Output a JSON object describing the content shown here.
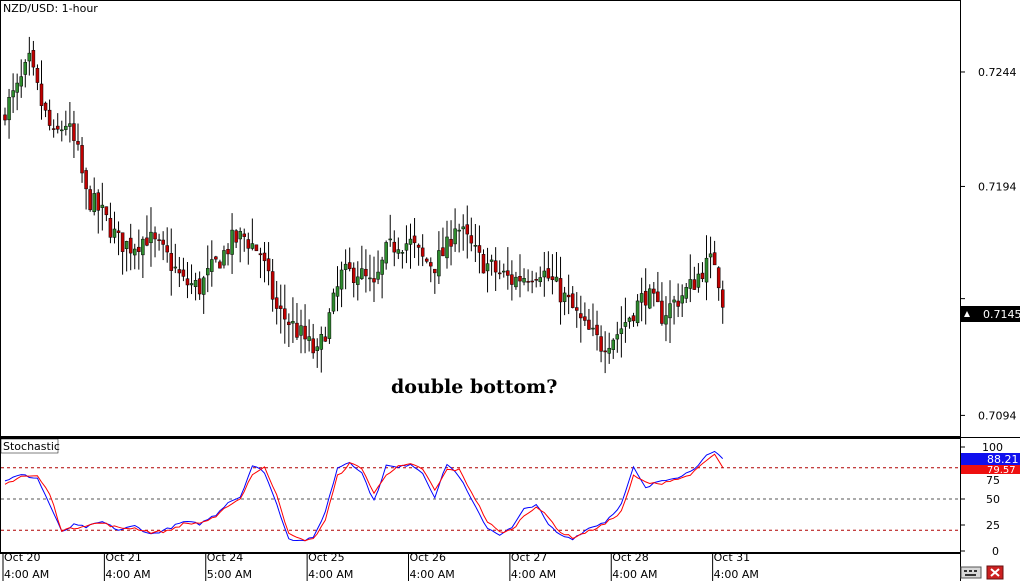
{
  "symbol_label": "NZD/USD: 1-hour",
  "indicator_label": "Stochastic",
  "annotation": "double bottom?",
  "current_price": "0.7145",
  "stoch_main_value": "88.21",
  "stoch_signal_value": "79.57",
  "colors": {
    "bull": "#2e8b2e",
    "bear": "#c00000",
    "stoch_main": "#0000ff",
    "stoch_signal": "#ff0000",
    "grid_dash": "#b00000",
    "badge_main": "#1010ee",
    "badge_signal": "#ee1010"
  },
  "chart_data": [
    {
      "type": "candlestick",
      "title": "NZD/USD: 1-hour",
      "ylim": [
        0.7085,
        0.7275
      ],
      "y_ticks": [
        "0.7244",
        "0.7194",
        "0.7145",
        "0.7094"
      ],
      "y_tick_values": [
        0.7244,
        0.7194,
        0.7145,
        0.7094
      ],
      "x_ticks": [
        {
          "top": "Oct 20",
          "bottom": "4:00 AM"
        },
        {
          "top": "Oct 21",
          "bottom": "4:00 AM"
        },
        {
          "top": "Oct 24",
          "bottom": "5:00 AM"
        },
        {
          "top": "Oct 25",
          "bottom": "4:00 AM"
        },
        {
          "top": "Oct 26",
          "bottom": "4:00 AM"
        },
        {
          "top": "Oct 27",
          "bottom": "4:00 AM"
        },
        {
          "top": "Oct 28",
          "bottom": "4:00 AM"
        },
        {
          "top": "Oct 31",
          "bottom": "4:00 AM"
        }
      ],
      "x_tick_bar_index": [
        0,
        25,
        50,
        75,
        100,
        125,
        150,
        175
      ],
      "close_path": [
        [
          0,
          0.7228
        ],
        [
          3,
          0.7236
        ],
        [
          6,
          0.7248
        ],
        [
          9,
          0.723
        ],
        [
          12,
          0.7215
        ],
        [
          15,
          0.7222
        ],
        [
          18,
          0.7208
        ],
        [
          20,
          0.719
        ],
        [
          24,
          0.7182
        ],
        [
          28,
          0.717
        ],
        [
          31,
          0.7168
        ],
        [
          35,
          0.7172
        ],
        [
          40,
          0.7163
        ],
        [
          44,
          0.7152
        ],
        [
          48,
          0.715
        ],
        [
          52,
          0.716
        ],
        [
          56,
          0.717
        ],
        [
          59,
          0.7172
        ],
        [
          63,
          0.7165
        ],
        [
          67,
          0.714
        ],
        [
          70,
          0.7135
        ],
        [
          74,
          0.7127
        ],
        [
          77,
          0.712
        ],
        [
          80,
          0.7137
        ],
        [
          83,
          0.7155
        ],
        [
          87,
          0.7157
        ],
        [
          91,
          0.7149
        ],
        [
          94,
          0.7165
        ],
        [
          97,
          0.717
        ],
        [
          100,
          0.7169
        ],
        [
          103,
          0.7162
        ],
        [
          106,
          0.716
        ],
        [
          109,
          0.7167
        ],
        [
          111,
          0.7178
        ],
        [
          114,
          0.717
        ],
        [
          117,
          0.7162
        ],
        [
          121,
          0.7157
        ],
        [
          125,
          0.7153
        ],
        [
          128,
          0.7155
        ],
        [
          132,
          0.7158
        ],
        [
          135,
          0.7152
        ],
        [
          139,
          0.7143
        ],
        [
          143,
          0.7132
        ],
        [
          147,
          0.7125
        ],
        [
          151,
          0.713
        ],
        [
          155,
          0.714
        ],
        [
          158,
          0.7147
        ],
        [
          162,
          0.7138
        ],
        [
          166,
          0.7145
        ],
        [
          169,
          0.715
        ],
        [
          172,
          0.7158
        ],
        [
          175,
          0.7162
        ],
        [
          177,
          0.7145
        ]
      ],
      "bars_count": 178
    },
    {
      "type": "line",
      "title": "Stochastic",
      "ylim": [
        0,
        100
      ],
      "y_ticks": [
        "100",
        "75",
        "50",
        "25",
        "0"
      ],
      "levels": [
        80,
        50,
        20
      ],
      "series": [
        {
          "values": [
            [
              0,
              68
            ],
            [
              4,
              73
            ],
            [
              8,
              70
            ],
            [
              11,
              45
            ],
            [
              14,
              18
            ],
            [
              17,
              25
            ],
            [
              20,
              23
            ],
            [
              24,
              28
            ],
            [
              28,
              20
            ],
            [
              32,
              24
            ],
            [
              36,
              16
            ],
            [
              40,
              21
            ],
            [
              44,
              28
            ],
            [
              48,
              26
            ],
            [
              52,
              35
            ],
            [
              55,
              47
            ],
            [
              58,
              52
            ],
            [
              61,
              82
            ],
            [
              64,
              76
            ],
            [
              67,
              45
            ],
            [
              70,
              12
            ],
            [
              73,
              10
            ],
            [
              76,
              12
            ],
            [
              79,
              38
            ],
            [
              82,
              80
            ],
            [
              85,
              86
            ],
            [
              88,
              75
            ],
            [
              91,
              48
            ],
            [
              94,
              82
            ],
            [
              97,
              80
            ],
            [
              100,
              84
            ],
            [
              103,
              75
            ],
            [
              106,
              52
            ],
            [
              109,
              84
            ],
            [
              112,
              72
            ],
            [
              116,
              42
            ],
            [
              119,
              22
            ],
            [
              122,
              16
            ],
            [
              125,
              22
            ],
            [
              128,
              40
            ],
            [
              131,
              45
            ],
            [
              134,
              25
            ],
            [
              137,
              15
            ],
            [
              140,
              12
            ],
            [
              144,
              22
            ],
            [
              148,
              28
            ],
            [
              152,
              45
            ],
            [
              155,
              80
            ],
            [
              158,
              60
            ],
            [
              161,
              67
            ],
            [
              164,
              70
            ],
            [
              167,
              72
            ],
            [
              170,
              80
            ],
            [
              173,
              91
            ],
            [
              175,
              95
            ],
            [
              177,
              88.21
            ]
          ]
        },
        {
          "values": [
            [
              0,
              64
            ],
            [
              4,
              72
            ],
            [
              8,
              72
            ],
            [
              11,
              55
            ],
            [
              14,
              20
            ],
            [
              17,
              22
            ],
            [
              20,
              25
            ],
            [
              24,
              27
            ],
            [
              28,
              22
            ],
            [
              32,
              22
            ],
            [
              36,
              18
            ],
            [
              40,
              19
            ],
            [
              44,
              26
            ],
            [
              48,
              27
            ],
            [
              52,
              32
            ],
            [
              55,
              44
            ],
            [
              58,
              50
            ],
            [
              61,
              74
            ],
            [
              64,
              80
            ],
            [
              67,
              55
            ],
            [
              70,
              16
            ],
            [
              73,
              11
            ],
            [
              76,
              11
            ],
            [
              79,
              30
            ],
            [
              82,
              72
            ],
            [
              85,
              84
            ],
            [
              88,
              80
            ],
            [
              91,
              55
            ],
            [
              94,
              74
            ],
            [
              97,
              81
            ],
            [
              100,
              83
            ],
            [
              103,
              79
            ],
            [
              106,
              58
            ],
            [
              109,
              78
            ],
            [
              112,
              78
            ],
            [
              116,
              50
            ],
            [
              119,
              28
            ],
            [
              122,
              18
            ],
            [
              125,
              20
            ],
            [
              128,
              34
            ],
            [
              131,
              43
            ],
            [
              134,
              32
            ],
            [
              137,
              18
            ],
            [
              140,
              13
            ],
            [
              144,
              19
            ],
            [
              148,
              26
            ],
            [
              152,
              38
            ],
            [
              155,
              72
            ],
            [
              158,
              66
            ],
            [
              161,
              64
            ],
            [
              164,
              68
            ],
            [
              167,
              70
            ],
            [
              170,
              76
            ],
            [
              173,
              87
            ],
            [
              175,
              93
            ],
            [
              177,
              79.57
            ]
          ]
        }
      ]
    }
  ]
}
